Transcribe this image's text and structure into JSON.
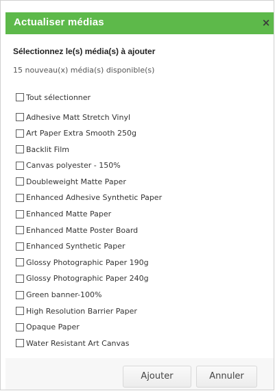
{
  "dialog": {
    "title": "Actualiser médias",
    "close_label": "×",
    "subtitle": "Sélectionnez le(s) média(s) à ajouter",
    "count_text": "15 nouveau(x) média(s) disponible(s)",
    "select_all_label": "Tout sélectionner",
    "accent_color": "#5db94a"
  },
  "media": [
    {
      "label": "Adhesive Matt Stretch Vinyl",
      "checked": false
    },
    {
      "label": "Art Paper Extra Smooth 250g",
      "checked": false
    },
    {
      "label": "Backlit Film",
      "checked": false
    },
    {
      "label": "Canvas polyester - 150%",
      "checked": false
    },
    {
      "label": "Doubleweight Matte Paper",
      "checked": false
    },
    {
      "label": "Enhanced Adhesive Synthetic Paper",
      "checked": false
    },
    {
      "label": "Enhanced Matte Paper",
      "checked": false
    },
    {
      "label": "Enhanced Matte Poster Board",
      "checked": false
    },
    {
      "label": "Enhanced Synthetic Paper",
      "checked": false
    },
    {
      "label": "Glossy Photographic Paper 190g",
      "checked": false
    },
    {
      "label": "Glossy Photographic Paper 240g",
      "checked": false
    },
    {
      "label": "Green banner-100%",
      "checked": false
    },
    {
      "label": "High Resolution Barrier Paper",
      "checked": false
    },
    {
      "label": "Opaque Paper",
      "checked": false
    },
    {
      "label": "Water Resistant Art Canvas",
      "checked": false
    }
  ],
  "footer": {
    "add_label": "Ajouter",
    "cancel_label": "Annuler"
  }
}
